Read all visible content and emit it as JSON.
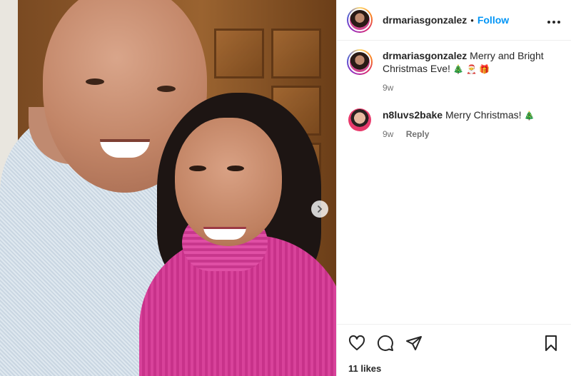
{
  "post": {
    "author": "drmariasgonzalez",
    "separator": "•",
    "follow_label": "Follow",
    "more_label": "•••"
  },
  "comments": [
    {
      "username": "drmariasgonzalez",
      "text": "Merry and Bright Christmas Eve!",
      "emojis": "🎄 🎅 🎁",
      "time": "9w"
    },
    {
      "username": "n8luvs2bake",
      "text": "Merry Christmas!",
      "emojis": "🎄",
      "time": "9w",
      "reply_label": "Reply"
    }
  ],
  "likes": "11 likes",
  "icons": {
    "next": "chevron-right-icon",
    "like": "heart-icon",
    "comment": "comment-icon",
    "share": "send-icon",
    "save": "bookmark-icon",
    "more": "more-icon"
  },
  "colors": {
    "link": "#0095f6",
    "text": "#262626",
    "meta": "#737373",
    "border": "#efefef"
  }
}
